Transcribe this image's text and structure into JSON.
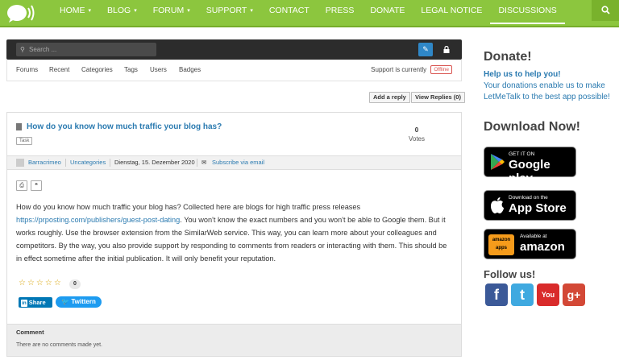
{
  "nav": {
    "items": [
      {
        "label": "HOME",
        "has_caret": true
      },
      {
        "label": "BLOG",
        "has_caret": true
      },
      {
        "label": "FORUM",
        "has_caret": true
      },
      {
        "label": "SUPPORT",
        "has_caret": true
      },
      {
        "label": "CONTACT",
        "has_caret": false
      },
      {
        "label": "PRESS",
        "has_caret": false
      },
      {
        "label": "DONATE",
        "has_caret": false
      },
      {
        "label": "LEGAL NOTICE",
        "has_caret": false
      },
      {
        "label": "DISCUSSIONS",
        "has_caret": false,
        "active": true
      }
    ],
    "caret": "▾",
    "search_icon": "search-icon",
    "bg_color": "#8cc63e"
  },
  "forum": {
    "search_placeholder": "Search ...",
    "tabs": [
      "Forums",
      "Recent",
      "Categories",
      "Tags",
      "Users",
      "Badges"
    ],
    "support_text": "Support is currently",
    "support_status": "Offline",
    "add_reply": "Add a reply",
    "view_replies": "View Replies (0)"
  },
  "post": {
    "title": "How do you know how much traffic your blog has?",
    "tag": "Task",
    "votes": "0",
    "votes_label": "Votes",
    "author": "Barracrimeo",
    "category": "Uncategories",
    "date": "Dienstag, 15. Dezember 2020",
    "subscribe": "Subscribe via email",
    "body_before_link": "How do you know how much traffic your blog has? Collected here are blogs for high traffic press releases ",
    "body_link": "https://prposting.com/publishers/guest-post-dating",
    "body_after_link": ". You won't know the exact numbers and you won't be able to Google them. But it works roughly. Use the browser extension from the SimilarWeb service. This way, you can learn more about your colleagues and competitors. By the way, you also provide support by responding to comments from readers or interacting with them. This should be in effect sometime after the initial publication. It will only benefit your reputation.",
    "stars": "☆☆☆☆☆",
    "rating_count": "0",
    "linkedin_in": "in",
    "linkedin_label": "Share",
    "twitter_label": "Twittern",
    "comment_title": "Comment",
    "comment_empty": "There are no comments made yet."
  },
  "sidebar": {
    "donate_title": "Donate!",
    "help_title": "Help us to help you!",
    "help_text": "Your donations enable us to make LetMeTalk to the best app possible!",
    "download_title": "Download Now!",
    "google_play": {
      "small": "GET IT ON",
      "big": "Google play"
    },
    "app_store": {
      "small": "Download on the",
      "big": "App Store"
    },
    "amazon": {
      "small": "Available at",
      "big": "amazon",
      "logo": "amazon apps"
    },
    "follow_title": "Follow us!",
    "social": [
      {
        "name": "facebook",
        "glyph": "f",
        "color": "#3b5998"
      },
      {
        "name": "twitter",
        "glyph": "t",
        "color": "#3fa9e0"
      },
      {
        "name": "youtube",
        "glyph": "You",
        "color": "#d92b2b"
      },
      {
        "name": "google-plus",
        "glyph": "g+",
        "color": "#d34836"
      }
    ]
  }
}
